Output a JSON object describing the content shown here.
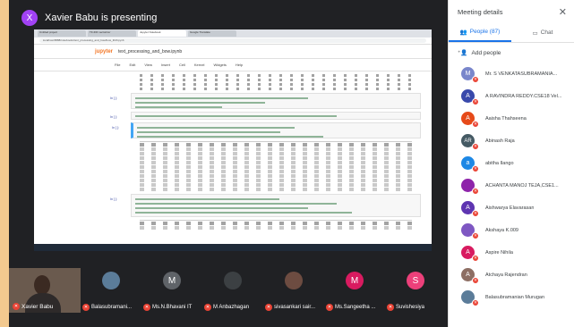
{
  "presenter": {
    "initial": "X",
    "title": "Xavier Babu is presenting",
    "color": "#a142f4"
  },
  "browser": {
    "tabs": [
      "Untitled project",
      "TF-IDF vectorizer",
      "Jupyter Notebook",
      "Google Translate"
    ],
    "url": "localhost:8888/notebooks/text_processing_and_bow/bow_tfidf.ipynb"
  },
  "notebook": {
    "logo": "jupyter",
    "name": "text_processing_and_bow.ipynb",
    "menu": [
      "File",
      "Edit",
      "View",
      "Insert",
      "Cell",
      "Kernel",
      "Widgets",
      "Help"
    ],
    "prompts": [
      "In [ ]:",
      "In [ ]:",
      "In [ ]:",
      "In [ ]:"
    ]
  },
  "self_tile": {
    "name": "Xavier Babu"
  },
  "tiles": [
    {
      "name": "Balasubramani...",
      "initial": "",
      "color": "#5b7c99"
    },
    {
      "name": "Ms.N.Bhavani IT",
      "initial": "M",
      "color": "#5f6368"
    },
    {
      "name": "M Anbazhagan",
      "initial": "",
      "color": "#3c4043"
    },
    {
      "name": "sivasankari sair...",
      "initial": "",
      "color": "#6d4c41"
    },
    {
      "name": "Ms.Sangeetha ...",
      "initial": "M",
      "color": "#d81b60"
    },
    {
      "name": "Suvishesiya",
      "initial": "S",
      "color": "#ec407a"
    }
  ],
  "panel": {
    "title": "Meeting details",
    "tab_people": "People (87)",
    "tab_chat": "Chat",
    "add_people": "Add people",
    "participants": [
      {
        "name": "Mr. S VENKATASUBRAMANIA...",
        "initial": "M",
        "color": "#7986cb"
      },
      {
        "name": "A RAVINDRA REDDY.CSE18 Vel...",
        "initial": "A",
        "color": "#3949ab"
      },
      {
        "name": "Aaisha Thahseena",
        "initial": "A",
        "color": "#e64a19"
      },
      {
        "name": "Abinash Raja",
        "initial": "AR",
        "color": "#455a64"
      },
      {
        "name": "abitha Ilango",
        "initial": "a",
        "color": "#1e88e5"
      },
      {
        "name": "ACHANTA MANOJ TEJA,CSE1...",
        "initial": "",
        "color": "#8e24aa"
      },
      {
        "name": "Aishwarya Elavarasan",
        "initial": "A",
        "color": "#5e35b1"
      },
      {
        "name": "Akshaya K.009",
        "initial": "",
        "color": "#7e57c2"
      },
      {
        "name": "Aspire Nihila",
        "initial": "A",
        "color": "#d81b60"
      },
      {
        "name": "Atchaya Rajendran",
        "initial": "A",
        "color": "#8d6e63"
      },
      {
        "name": "Balasubramanian Murugan",
        "initial": "",
        "color": "#5b7c99"
      }
    ]
  },
  "icons": {
    "close": "close-icon",
    "people": "people-icon",
    "chat": "chat-icon",
    "add": "add-person-icon",
    "mic_off": "mic-off-icon"
  }
}
